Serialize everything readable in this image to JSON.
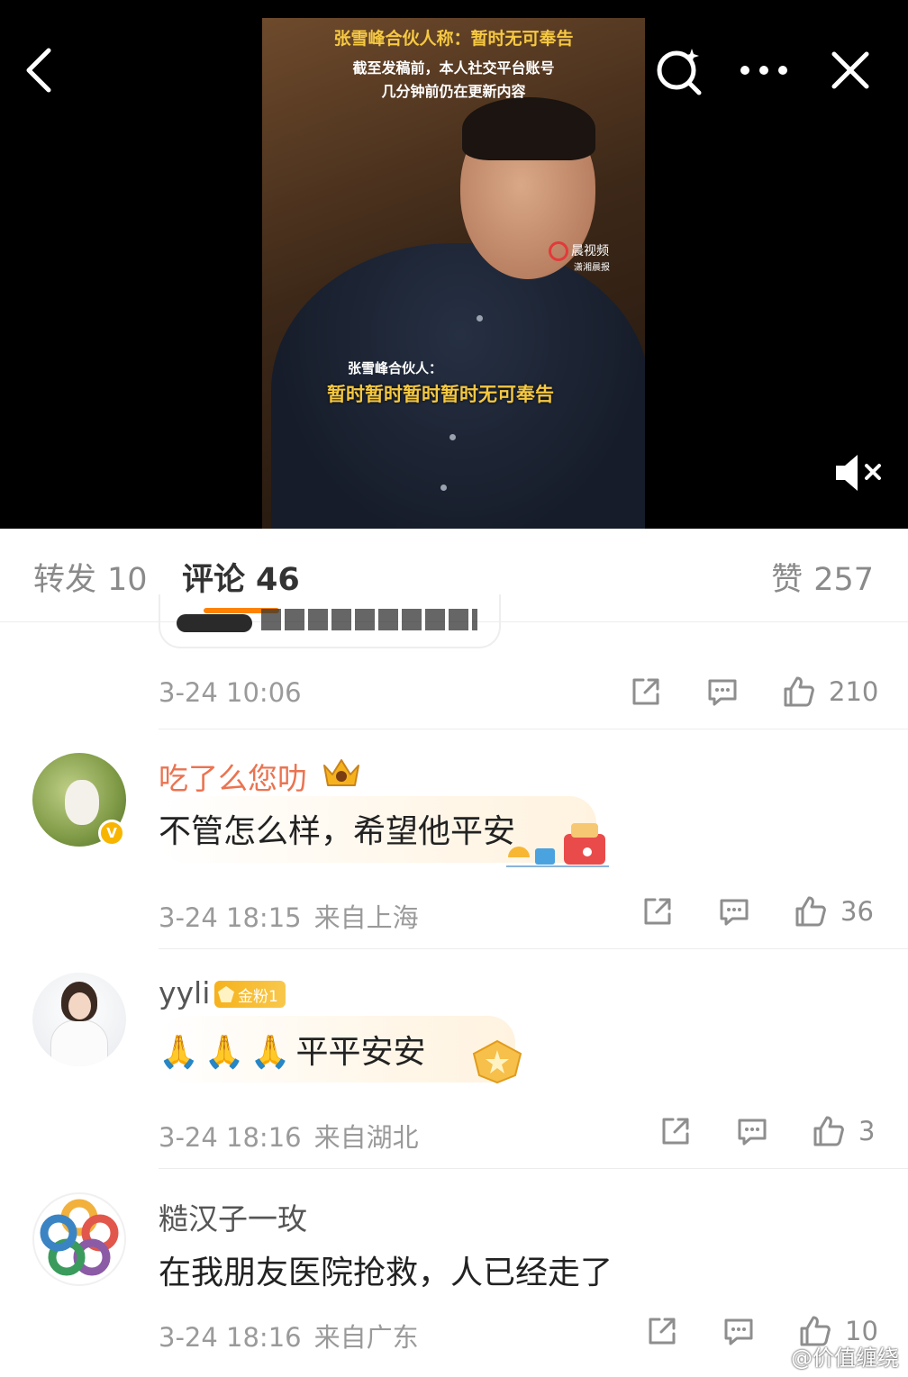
{
  "video": {
    "caption_title": "张雪峰合伙人称：暂时无可奉告",
    "caption_line2": "截至发稿前，本人社交平台账号",
    "caption_line3": "几分钟前仍在更新内容",
    "caption_speaker": "张雪峰合伙人：",
    "caption_subtitle": "暂时暂时暂时暂时无可奉告",
    "watermark_name": "晨视频",
    "watermark_sub": "潇湘晨报"
  },
  "topbar": {
    "back_icon": "chevron-left-icon",
    "search_icon": "search-sparkle-icon",
    "more_icon": "more-dots-icon",
    "close_icon": "close-icon",
    "mute_icon": "speaker-muted-icon"
  },
  "tabs": {
    "repost_label": "转发",
    "repost_count": "10",
    "comment_label": "评论",
    "comment_count": "46",
    "like_label": "赞",
    "like_count": "257",
    "accent_color": "#ff8200"
  },
  "comments": [
    {
      "time": "3-24 10:06",
      "location": "",
      "likes": "210"
    },
    {
      "username": "吃了么您叻",
      "text": "不管怎么样，希望他平安",
      "time": "3-24 18:15",
      "location": "来自上海",
      "likes": "36",
      "username_color": "#eb7350"
    },
    {
      "username": "yyli",
      "fan_badge": "金粉1",
      "text": "平平安安",
      "time": "3-24 18:16",
      "location": "来自湖北",
      "likes": "3"
    },
    {
      "username": "糙汉子一玫",
      "text": "在我朋友医院抢救，人已经走了",
      "time": "3-24 18:16",
      "location": "来自广东",
      "likes": "10"
    }
  ],
  "watermark": "@价值缠绕",
  "verified_mark": "V"
}
